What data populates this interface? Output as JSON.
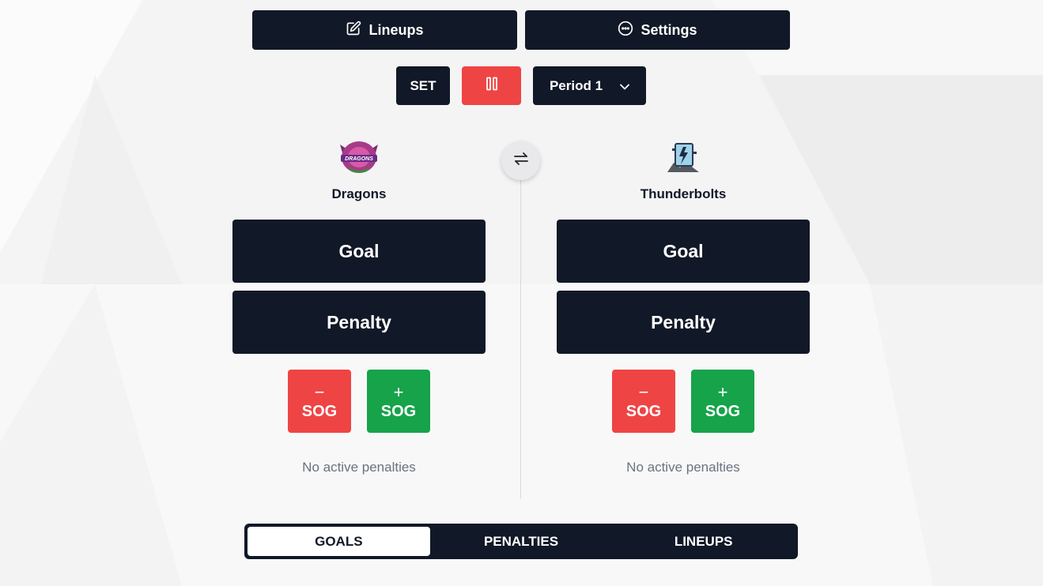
{
  "toolbar": {
    "lineups_label": "Lineups",
    "settings_label": "Settings"
  },
  "clock": {
    "set_label": "SET",
    "period_label": "Period 1"
  },
  "teams": {
    "home": {
      "name": "Dragons",
      "logo_text": "DRAGONS",
      "goal_label": "Goal",
      "penalty_label": "Penalty",
      "sog_label": "SOG",
      "minus_symbol": "−",
      "plus_symbol": "+",
      "penalties_status": "No active penalties"
    },
    "away": {
      "name": "Thunderbolts",
      "goal_label": "Goal",
      "penalty_label": "Penalty",
      "sog_label": "SOG",
      "minus_symbol": "−",
      "plus_symbol": "+",
      "penalties_status": "No active penalties"
    }
  },
  "tabs": [
    "GOALS",
    "PENALTIES",
    "LINEUPS"
  ],
  "colors": {
    "dark": "#111827",
    "red": "#ef4444",
    "green": "#16a34a"
  }
}
